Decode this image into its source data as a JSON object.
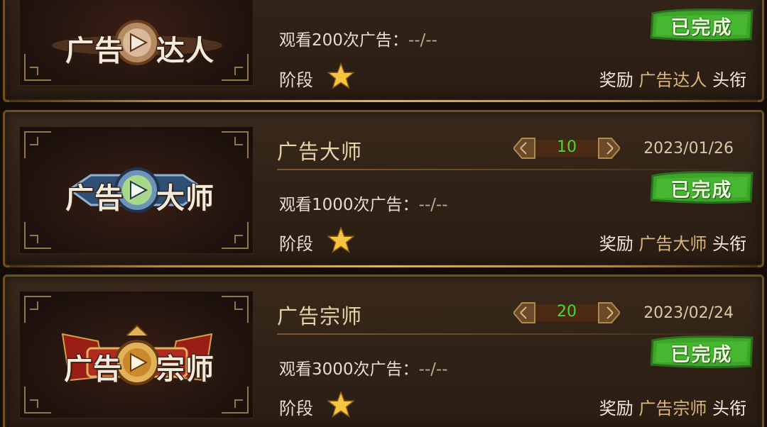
{
  "achievements": [
    {
      "badge_text": [
        "广告",
        "达人"
      ],
      "title": "",
      "level": "",
      "date": "",
      "description": "观看200次广告：",
      "progress": "--/--",
      "stage_label": "阶段",
      "stars": 1,
      "status": "已完成",
      "reward_prefix": "奖励",
      "reward_name": "广告达人",
      "reward_suffix": "头衔",
      "badge_color": "#8a4a2a"
    },
    {
      "badge_text": [
        "广告",
        "大师"
      ],
      "title": "广告大师",
      "level": "10",
      "date": "2023/01/26",
      "description": "观看1000次广告：",
      "progress": "--/--",
      "stage_label": "阶段",
      "stars": 1,
      "status": "已完成",
      "reward_prefix": "奖励",
      "reward_name": "广告大师",
      "reward_suffix": "头衔",
      "badge_color": "#2f5a8a"
    },
    {
      "badge_text": [
        "广告",
        "宗师"
      ],
      "title": "广告宗师",
      "level": "20",
      "date": "2023/02/24",
      "description": "观看3000次广告：",
      "progress": "--/--",
      "stage_label": "阶段",
      "stars": 1,
      "status": "已完成",
      "reward_prefix": "奖励",
      "reward_name": "广告宗师",
      "reward_suffix": "头衔",
      "badge_color": "#a8261c"
    }
  ],
  "colors": {
    "level_text": "#3fdc38",
    "done_green": "#3da52a",
    "frame_gold": "#b08a4a",
    "star_gold": "#f5c542"
  }
}
